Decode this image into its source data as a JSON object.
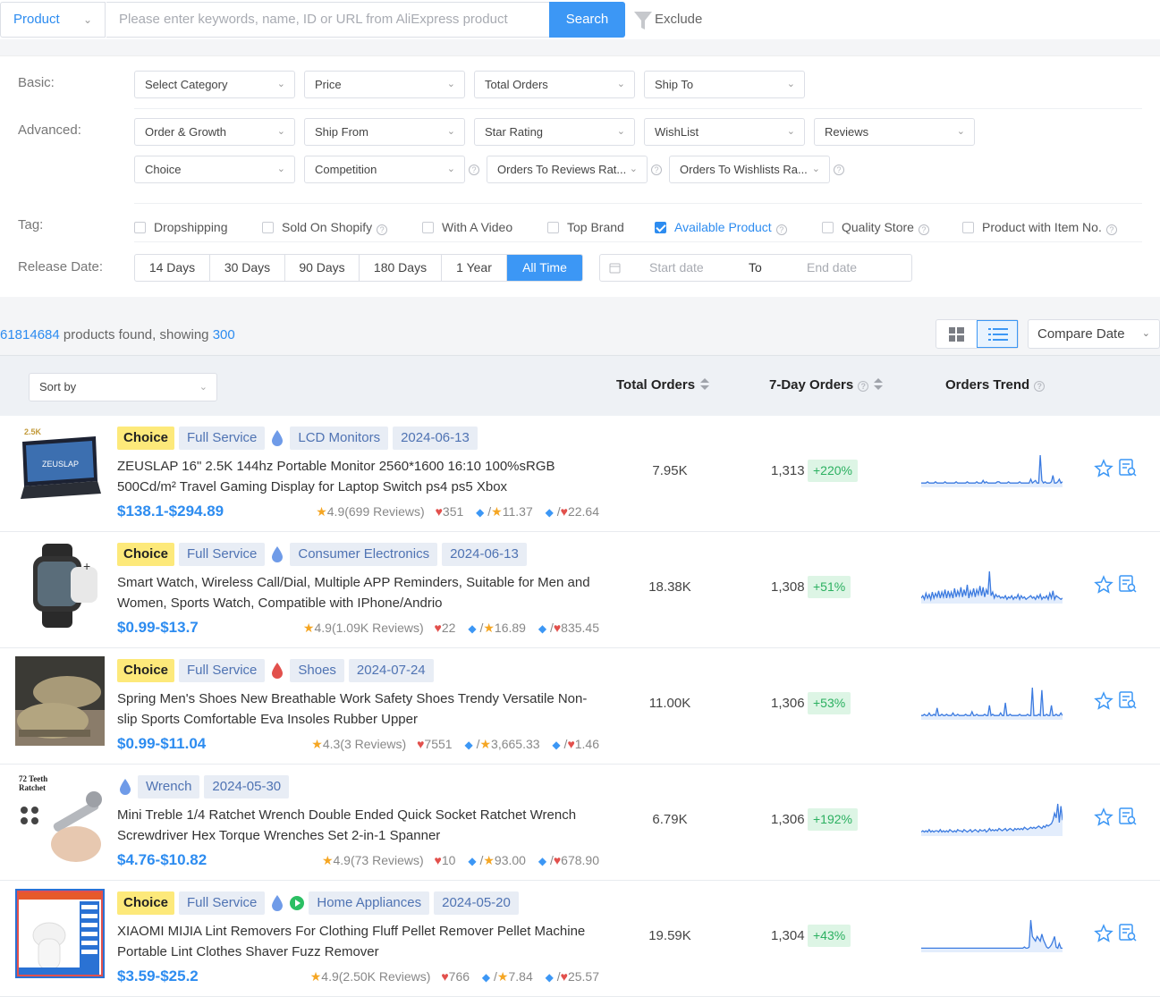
{
  "search": {
    "mode": "Product",
    "placeholder": "Please enter keywords,  name, ID or URL from AliExpress product",
    "button": "Search",
    "exclude": "Exclude"
  },
  "filters": {
    "basic_label": "Basic:",
    "basic": [
      "Select Category",
      "Price",
      "Total Orders",
      "Ship To"
    ],
    "advanced_label": "Advanced:",
    "advanced_row1": [
      "Order & Growth",
      "Ship From",
      "Star Rating",
      "WishList",
      "Reviews"
    ],
    "advanced_row2": [
      "Choice",
      "Competition",
      "Orders To Reviews Rat...",
      "Orders To Wishlists Ra..."
    ],
    "tag_label": "Tag:",
    "tags": [
      {
        "label": "Dropshipping",
        "checked": false,
        "help": false
      },
      {
        "label": "Sold On Shopify",
        "checked": false,
        "help": true
      },
      {
        "label": "With A Video",
        "checked": false,
        "help": false
      },
      {
        "label": "Top Brand",
        "checked": false,
        "help": false
      },
      {
        "label": "Available Product",
        "checked": true,
        "help": true
      },
      {
        "label": "Quality Store",
        "checked": false,
        "help": true
      },
      {
        "label": "Product with Item No.",
        "checked": false,
        "help": true
      }
    ],
    "release_label": "Release Date:",
    "release_options": [
      "14 Days",
      "30 Days",
      "90 Days",
      "180 Days",
      "1 Year",
      "All Time"
    ],
    "release_selected": "All Time",
    "start_placeholder": "Start date",
    "to": "To",
    "end_placeholder": "End date"
  },
  "results": {
    "count": "61814684",
    "found_text": " products found, showing ",
    "showing": "300",
    "compare_label": "Compare Date"
  },
  "table": {
    "sort_placeholder": "Sort by",
    "col_total": "Total Orders",
    "col_seven": "7-Day Orders",
    "col_trend": "Orders Trend"
  },
  "rows": [
    {
      "choice": "Choice",
      "service": "Full Service",
      "drop_color": "#6f9be8",
      "video": false,
      "category": "LCD Monitors",
      "date": "2024-06-13",
      "title": "ZEUSLAP 16\" 2.5K 144hz Portable Monitor 2560*1600 16:10 100%sRGB 500Cd/m² Travel Gaming Display for Laptop Switch ps4 ps5 Xbox",
      "price": "$138.1-$294.89",
      "rating": "4.9(699 Reviews)",
      "wish": "351",
      "ratio1": "11.37",
      "ratio2": "22.64",
      "total": "7.95K",
      "seven": "1,313",
      "growth": "+220%",
      "trend": [
        2,
        2,
        2,
        2,
        3,
        2,
        2,
        2,
        2,
        3,
        2,
        2,
        2,
        2,
        2,
        3,
        2,
        2,
        2,
        2,
        2,
        2,
        3,
        2,
        2,
        2,
        2,
        2,
        2,
        3,
        2,
        2,
        2,
        2,
        2,
        3,
        2,
        2,
        2,
        4,
        2,
        3,
        2,
        2,
        2,
        2,
        2,
        2,
        3,
        3,
        2,
        2,
        2,
        2,
        2,
        3,
        2,
        2,
        2,
        2,
        2,
        2,
        3,
        2,
        2,
        2,
        2,
        2,
        2,
        5,
        2,
        3,
        4,
        2,
        2,
        24,
        4,
        2,
        3,
        2,
        2,
        2,
        3,
        8,
        2,
        2,
        3,
        5,
        2,
        3
      ]
    },
    {
      "choice": "Choice",
      "service": "Full Service",
      "drop_color": "#6f9be8",
      "video": false,
      "category": "Consumer Electronics",
      "date": "2024-06-13",
      "title": "Smart Watch, Wireless Call/Dial, Multiple APP Reminders, Suitable for Men and Women, Sports Watch, Compatible with IPhone/Andrio",
      "price": "$0.99-$13.7",
      "rating": "4.9(1.09K Reviews)",
      "wish": "22",
      "ratio1": "16.89",
      "ratio2": "835.45",
      "total": "18.38K",
      "seven": "1,308",
      "growth": "+51%",
      "trend": [
        3,
        5,
        2,
        7,
        3,
        6,
        2,
        8,
        3,
        7,
        4,
        9,
        3,
        8,
        4,
        10,
        3,
        9,
        4,
        8,
        3,
        11,
        4,
        9,
        5,
        12,
        4,
        10,
        5,
        14,
        3,
        9,
        5,
        11,
        4,
        10,
        6,
        13,
        5,
        12,
        4,
        10,
        6,
        25,
        5,
        8,
        3,
        6,
        4,
        5,
        3,
        4,
        3,
        5,
        2,
        4,
        3,
        5,
        2,
        4,
        3,
        6,
        2,
        5,
        3,
        4,
        2,
        3,
        4,
        5,
        3,
        4,
        2,
        5,
        3,
        6,
        2,
        4,
        3,
        5,
        2,
        7,
        3,
        9,
        2,
        5,
        4,
        3,
        2,
        3
      ]
    },
    {
      "choice": "Choice",
      "service": "Full Service",
      "drop_color": "#e2504c",
      "video": false,
      "category": "Shoes",
      "date": "2024-07-24",
      "title": "Spring Men's Shoes New Breathable Work Safety Shoes Trendy Versatile Non-slip Sports Comfortable Eva Insoles Rubber Upper",
      "price": "$0.99-$11.04",
      "rating": "4.3(3 Reviews)",
      "wish": "7551",
      "ratio1": "3,665.33",
      "ratio2": "1.46",
      "total": "11.00K",
      "seven": "1,306",
      "growth": "+53%",
      "trend": [
        2,
        2,
        3,
        2,
        2,
        4,
        2,
        2,
        3,
        2,
        8,
        2,
        2,
        3,
        2,
        2,
        3,
        2,
        2,
        2,
        4,
        2,
        2,
        3,
        2,
        2,
        2,
        2,
        3,
        2,
        2,
        2,
        5,
        2,
        2,
        3,
        2,
        2,
        2,
        2,
        3,
        2,
        2,
        10,
        2,
        3,
        2,
        2,
        2,
        2,
        4,
        2,
        2,
        12,
        2,
        2,
        3,
        2,
        2,
        2,
        2,
        2,
        3,
        2,
        2,
        2,
        2,
        3,
        2,
        2,
        24,
        2,
        2,
        2,
        3,
        2,
        22,
        2,
        2,
        3,
        2,
        2,
        10,
        2,
        2,
        3,
        2,
        2,
        4,
        2
      ]
    },
    {
      "choice": "",
      "service": "",
      "drop_color": "#6f9be8",
      "video": false,
      "category": "Wrench",
      "date": "2024-05-30",
      "title": "Mini Treble 1/4 Ratchet Wrench Double Ended Quick Socket Ratchet Wrench Screwdriver Hex Torque Wrenches Set 2-in-1 Spanner",
      "price": "$4.76-$10.82",
      "rating": "4.9(73 Reviews)",
      "wish": "10",
      "ratio1": "93.00",
      "ratio2": "678.90",
      "total": "6.79K",
      "seven": "1,306",
      "growth": "+192%",
      "trend": [
        2,
        3,
        2,
        3,
        2,
        4,
        2,
        3,
        2,
        3,
        3,
        2,
        4,
        2,
        3,
        2,
        3,
        2,
        4,
        3,
        2,
        3,
        2,
        4,
        3,
        3,
        2,
        4,
        3,
        2,
        3,
        4,
        2,
        3,
        4,
        3,
        2,
        4,
        3,
        3,
        4,
        2,
        3,
        5,
        3,
        4,
        3,
        4,
        3,
        5,
        4,
        3,
        4,
        5,
        3,
        4,
        5,
        4,
        3,
        5,
        4,
        5,
        4,
        5,
        4,
        6,
        5,
        4,
        5,
        6,
        5,
        6,
        5,
        6,
        7,
        6,
        5,
        7,
        6,
        8,
        7,
        8,
        9,
        12,
        18,
        14,
        26,
        10,
        24,
        12
      ]
    },
    {
      "choice": "Choice",
      "service": "Full Service",
      "drop_color": "#6f9be8",
      "video": true,
      "category": "Home Appliances",
      "date": "2024-05-20",
      "title": "XIAOMI MIJIA Lint Removers For Clothing Fluff Pellet Remover Pellet Machine Portable Lint Clothes Shaver Fuzz Remover",
      "price": "$3.59-$25.2",
      "rating": "4.9(2.50K Reviews)",
      "wish": "766",
      "ratio1": "7.84",
      "ratio2": "25.57",
      "total": "19.59K",
      "seven": "1,304",
      "growth": "+43%",
      "trend": [
        2,
        2,
        2,
        2,
        2,
        2,
        2,
        2,
        2,
        2,
        2,
        2,
        2,
        2,
        2,
        2,
        2,
        2,
        2,
        2,
        2,
        2,
        2,
        2,
        2,
        2,
        2,
        2,
        2,
        2,
        2,
        2,
        2,
        2,
        2,
        2,
        2,
        2,
        2,
        2,
        2,
        2,
        2,
        2,
        2,
        2,
        2,
        2,
        2,
        2,
        2,
        2,
        2,
        2,
        2,
        2,
        2,
        2,
        2,
        2,
        2,
        2,
        2,
        2,
        2,
        3,
        2,
        2,
        3,
        26,
        12,
        10,
        8,
        12,
        10,
        8,
        14,
        9,
        6,
        3,
        2,
        3,
        5,
        8,
        12,
        3,
        2,
        6,
        2,
        2
      ]
    }
  ]
}
